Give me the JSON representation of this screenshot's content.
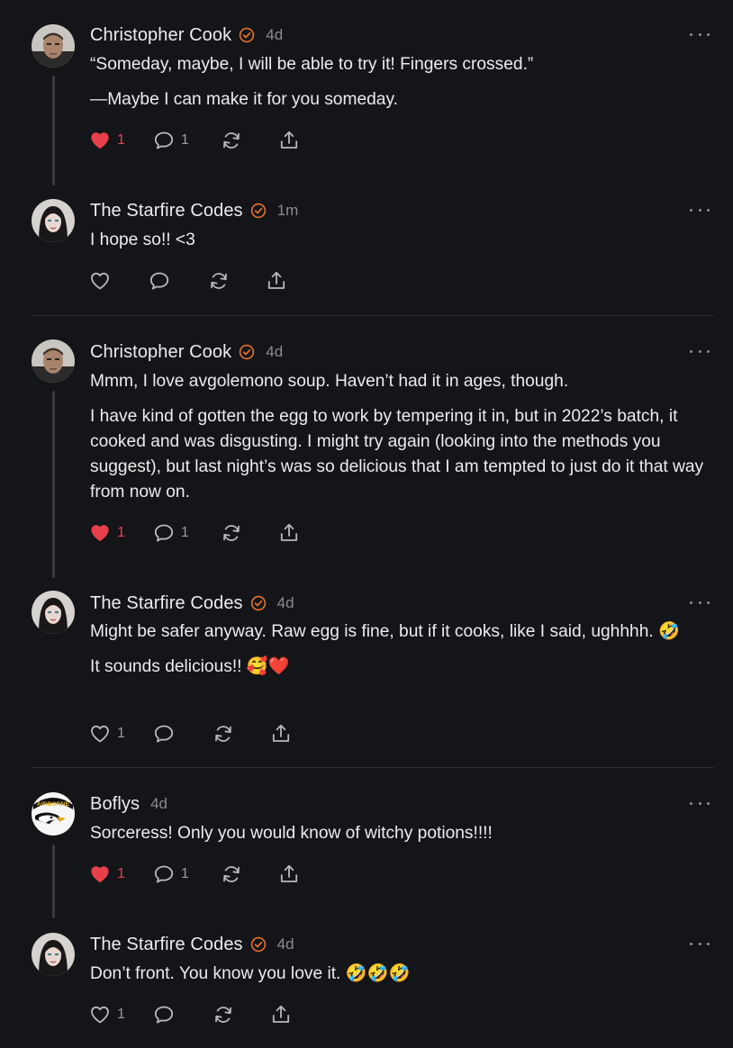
{
  "colors": {
    "background": "#141518",
    "liked": "#e8404a",
    "verified": "#e8722c",
    "muted": "#8b8c92"
  },
  "comments": [
    {
      "author": "Christopher Cook",
      "verified": true,
      "time": "4d",
      "paragraphs": [
        "“Someday, maybe, I will be able to try it! Fingers crossed.”",
        "—Maybe I can make it for you someday."
      ],
      "likes": "1",
      "liked": true,
      "replies": "1",
      "avatar": "man-avatar"
    },
    {
      "author": "The Starfire Codes",
      "verified": true,
      "time": "1m",
      "paragraphs": [
        "I hope so!! <3"
      ],
      "likes": "",
      "liked": false,
      "replies": "",
      "avatar": "woman-avatar"
    },
    {
      "author": "Christopher Cook",
      "verified": true,
      "time": "4d",
      "paragraphs": [
        "Mmm, I love avgolemono soup. Haven’t had it in ages, though.",
        "I have kind of gotten the egg to work by tempering it in, but in 2022’s batch, it cooked and was disgusting. I might try again (looking into the methods you suggest), but last night’s was so delicious that I am tempted to just do it that way from now on."
      ],
      "likes": "1",
      "liked": true,
      "replies": "1",
      "avatar": "man-avatar"
    },
    {
      "author": "The Starfire Codes",
      "verified": true,
      "time": "4d",
      "paragraphs": [
        "Might be safer anyway. Raw egg is fine, but if it cooks, like I said, ughhhh. 🤣",
        "It sounds delicious!! 🥰❤️"
      ],
      "likes": "1",
      "liked": false,
      "replies": "",
      "avatar": "woman-avatar"
    },
    {
      "author": "Boflys",
      "verified": false,
      "time": "4d",
      "paragraphs": [
        "Sorceress! Only you would know of witchy potions!!!!"
      ],
      "likes": "1",
      "liked": true,
      "replies": "1",
      "avatar": "airborne-avatar",
      "avatar_text": "AIRBORNE"
    },
    {
      "author": "The Starfire Codes",
      "verified": true,
      "time": "4d",
      "paragraphs": [
        "Don’t front. You know you love it. 🤣🤣🤣"
      ],
      "likes": "1",
      "liked": false,
      "replies": "",
      "avatar": "woman-avatar"
    }
  ]
}
